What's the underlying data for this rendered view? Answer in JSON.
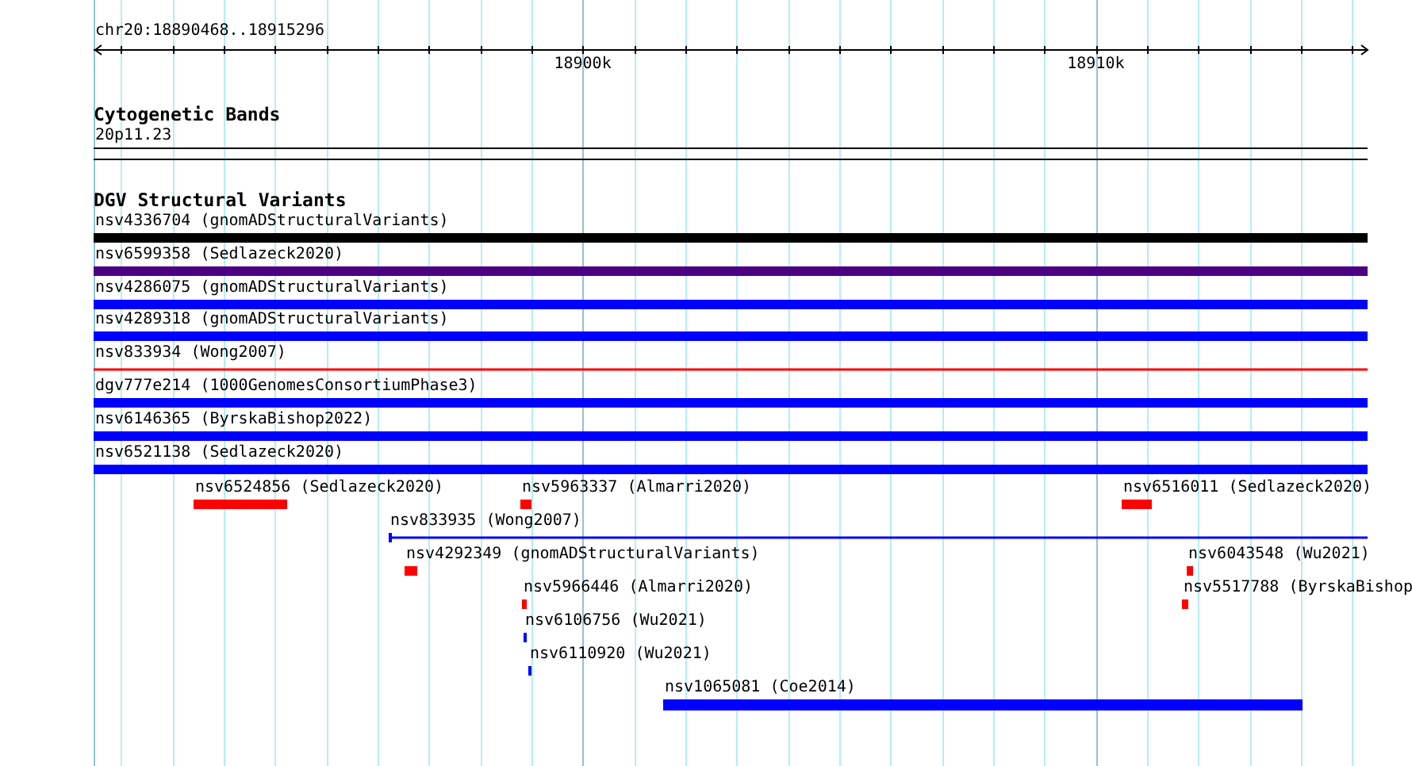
{
  "ruler": {
    "position_label": "chr20:18890468..18915296",
    "tick_labels": [
      "18900k",
      "18910k"
    ]
  },
  "cytogenetic_track": {
    "title": "Cytogenetic Bands",
    "band_label": "20p11.23"
  },
  "dgv_track": {
    "title": "DGV Structural Variants",
    "features": [
      {
        "label": "nsv4336704 (gnomADStructuralVariants)",
        "kind": "bar",
        "color": "#000000"
      },
      {
        "label": "nsv6599358 (Sedlazeck2020)",
        "kind": "bar",
        "color": "#4b0082"
      },
      {
        "label": "nsv4286075 (gnomADStructuralVariants)",
        "kind": "bar",
        "color": "#0000ff"
      },
      {
        "label": "nsv4289318 (gnomADStructuralVariants)",
        "kind": "bar",
        "color": "#0000ff"
      },
      {
        "label": "nsv833934 (Wong2007)",
        "kind": "line",
        "color": "#ff0000"
      },
      {
        "label": "dgv777e214 (1000GenomesConsortiumPhase3)",
        "kind": "bar",
        "color": "#0000ff"
      },
      {
        "label": "nsv6146365 (ByrskaBishop2022)",
        "kind": "bar",
        "color": "#0000ff"
      },
      {
        "label": "nsv6521138 (Sedlazeck2020)",
        "kind": "bar",
        "color": "#0000ff"
      },
      {
        "label": "nsv6524856 (Sedlazeck2020)",
        "kind": "bar",
        "color": "#ff0000"
      },
      {
        "label": "nsv5963337 (Almarri2020)",
        "kind": "bar",
        "color": "#ff0000"
      },
      {
        "label": "nsv6516011 (Sedlazeck2020)",
        "kind": "bar",
        "color": "#ff0000"
      },
      {
        "label": "nsv833935 (Wong2007)",
        "kind": "line",
        "color": "#0000ff"
      },
      {
        "label": "nsv4292349 (gnomADStructuralVariants)",
        "kind": "bar",
        "color": "#ff0000"
      },
      {
        "label": "nsv6043548 (Wu2021)",
        "kind": "bar",
        "color": "#ff0000"
      },
      {
        "label": "nsv5966446 (Almarri2020)",
        "kind": "bar",
        "color": "#ff0000"
      },
      {
        "label": "nsv5517788 (ByrskaBishop",
        "kind": "bar",
        "color": "#ff0000"
      },
      {
        "label": "nsv6106756 (Wu2021)",
        "kind": "bar",
        "color": "#0000ff"
      },
      {
        "label": "nsv6110920 (Wu2021)",
        "kind": "bar",
        "color": "#0000ff"
      },
      {
        "label": "nsv1065081 (Coe2014)",
        "kind": "bar",
        "color": "#0000ff"
      }
    ]
  }
}
